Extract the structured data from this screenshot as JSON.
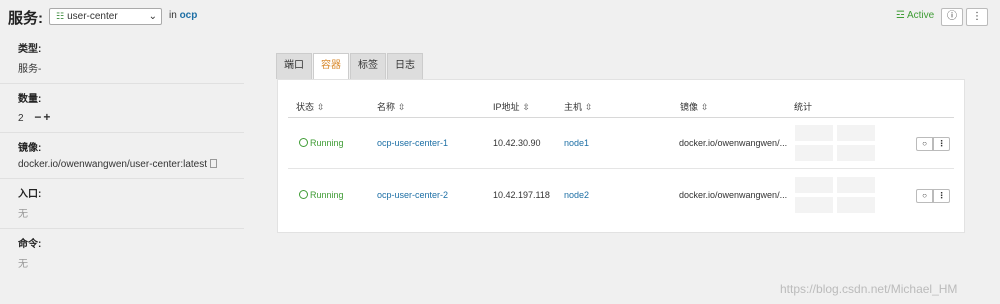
{
  "header": {
    "label": "服务:",
    "selected_service": "user-center",
    "in_prefix": "in",
    "namespace": "ocp",
    "status": "Active",
    "help_icon": "question-circle-icon",
    "menu_icon": "kebab-icon"
  },
  "details": {
    "type_label": "类型:",
    "type_value": "服务-",
    "count_label": "数量:",
    "count_value": "2",
    "stepper": "−+",
    "image_label": "镜像:",
    "image_value": "docker.io/owenwangwen/user-center:latest",
    "entry_label": "入口:",
    "entry_value": "无",
    "command_label": "命令:",
    "command_value": "无"
  },
  "tabs": [
    {
      "label": "端口"
    },
    {
      "label": "容器"
    },
    {
      "label": "标签"
    },
    {
      "label": "日志"
    }
  ],
  "active_tab": "容器",
  "table": {
    "headers": {
      "status": "状态",
      "name": "名称",
      "ip": "IP地址",
      "host": "主机",
      "image": "镜像",
      "stats": "统计"
    },
    "rows": [
      {
        "status": "Running",
        "name": "ocp-user-center-1",
        "ip": "10.42.30.90",
        "host": "node1",
        "image": "docker.io/owenwangwen/..."
      },
      {
        "status": "Running",
        "name": "ocp-user-center-2",
        "ip": "10.42.197.118",
        "host": "node2",
        "image": "docker.io/owenwangwen/..."
      }
    ]
  },
  "watermark": "https://blog.csdn.net/Michael_HM",
  "colors": {
    "accent_link": "#1d6fa5",
    "status_green": "#3f9c35",
    "active_tab": "#d98a2e"
  }
}
